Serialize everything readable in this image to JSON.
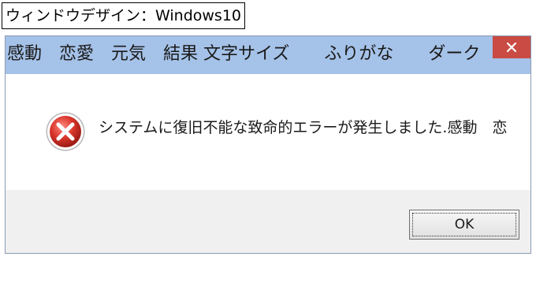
{
  "caption": "ウィンドウデザイン：Windows10",
  "dialog": {
    "title": "感動　恋愛　元気　結果 文字サイズ　　ふりがな　　ダーク",
    "message": "システムに復旧不能な致命的エラーが発生しました.感動　恋",
    "ok_label": "OK"
  },
  "colors": {
    "titlebar": "#a5c2e8",
    "close_button": "#c94b43",
    "footer": "#f0f0f0",
    "error_icon": "#d9352b"
  },
  "icons": {
    "close": "close-icon",
    "error": "error-icon"
  }
}
